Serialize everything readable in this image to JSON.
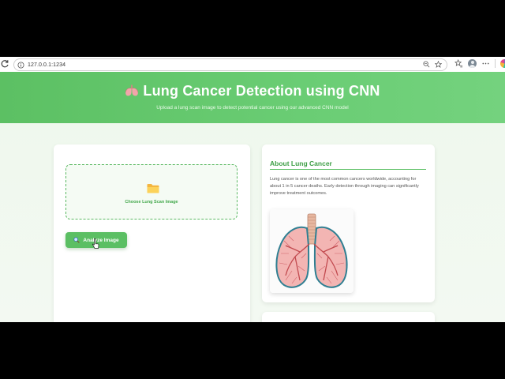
{
  "browser": {
    "url": "127.0.0.1:1234"
  },
  "hero": {
    "title": "Lung Cancer Detection using CNN",
    "subtitle": "Upload a lung scan image to detect potential cancer using our advanced CNN model"
  },
  "upload": {
    "choose_label": "Choose Lung Scan Image",
    "analyze_label": "Analyze Image"
  },
  "about": {
    "title": "About Lung Cancer",
    "text": "Lung cancer is one of the most common cancers worldwide, accounting for about 1 in 5 cancer deaths. Early detection through imaging can significantly improve treatment outcomes."
  },
  "icons": {
    "hero": "lungs-icon",
    "upload": "folder-icon",
    "analyze": "search-icon"
  },
  "colors": {
    "accent": "#5bbf63",
    "accent_text": "#3e9e46"
  }
}
